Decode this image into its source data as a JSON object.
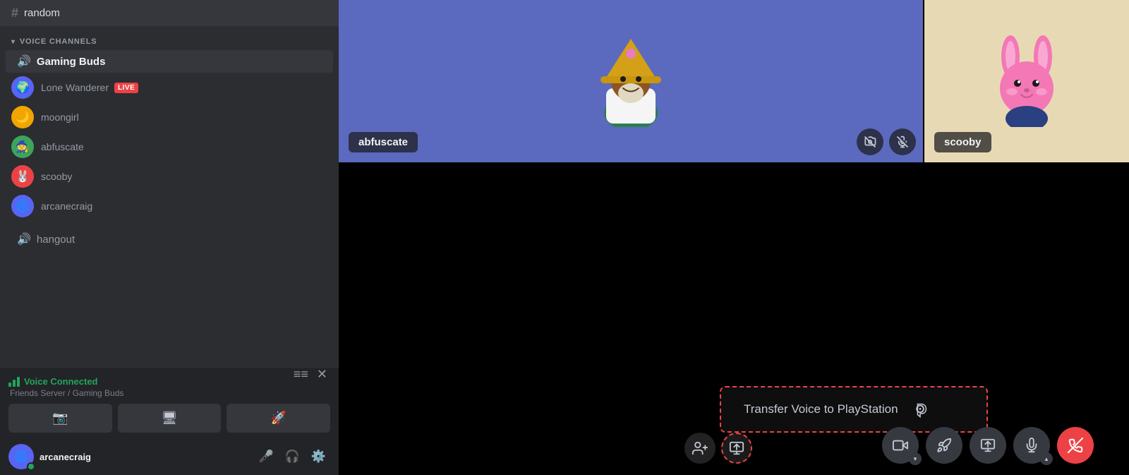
{
  "sidebar": {
    "channels": [
      {
        "type": "text",
        "name": "random"
      }
    ],
    "voice_section_label": "VOICE CHANNELS",
    "voice_channels": [
      {
        "name": "Gaming Buds",
        "active": true,
        "members": [
          {
            "name": "Lone Wanderer",
            "live": true,
            "avatar_color": "#5865f2",
            "avatar_emoji": "🌍"
          },
          {
            "name": "moongirl",
            "live": false,
            "avatar_color": "#f0a500",
            "avatar_emoji": "🌙"
          },
          {
            "name": "abfuscate",
            "live": false,
            "avatar_color": "#3ba55c",
            "avatar_emoji": "🧙"
          },
          {
            "name": "scooby",
            "live": false,
            "avatar_color": "#ed4245",
            "avatar_emoji": "🐰"
          },
          {
            "name": "arcanecraig",
            "live": false,
            "avatar_color": "#5865f2",
            "avatar_emoji": "🌀"
          }
        ]
      },
      {
        "name": "hangout",
        "active": false,
        "members": []
      }
    ],
    "voice_connected": {
      "status": "Voice Connected",
      "server": "Friends Server / Gaming Buds"
    },
    "controls": {
      "camera_label": "📷",
      "screen_label": "🖥",
      "activity_label": "🚀"
    },
    "user": {
      "name": "arcanecraig",
      "avatar_emoji": "🌀",
      "avatar_color": "#5865f2"
    }
  },
  "main": {
    "video_tiles": [
      {
        "username": "abfuscate",
        "bg_color": "#5b6abf",
        "muted_video": true,
        "muted_audio": true
      },
      {
        "username": "scooby",
        "bg_color": "#e8d9b5",
        "muted_video": false,
        "muted_audio": false
      }
    ],
    "transfer_voice": {
      "text": "Transfer Voice to PlayStation",
      "icon": "PlayStation"
    },
    "bottom_controls": {
      "camera": "📷",
      "activity": "🚀",
      "screen": "🖥",
      "mic": "🎤",
      "end_call": "📞"
    }
  },
  "badges": {
    "live": "LIVE"
  }
}
